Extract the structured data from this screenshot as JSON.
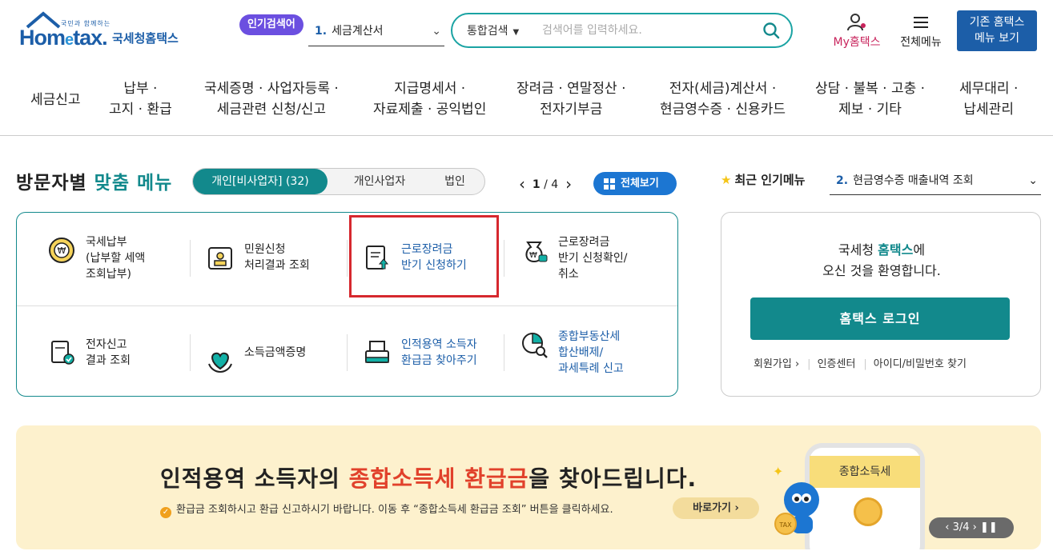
{
  "header": {
    "logo_sub": "국민과 함께하는",
    "logo_brand_a": "Hom",
    "logo_brand_e": "e",
    "logo_brand_b": "tax.",
    "logo_korean": "국세청홈택스",
    "popular_badge": "인기검색어",
    "popular_num": "1.",
    "popular_value": "세금계산서",
    "search_category": "통합검색",
    "search_placeholder": "검색어를 입력하세요.",
    "my_hometax": "My홈택스",
    "all_menu": "전체메뉴",
    "old_view_line1": "기존 홈택스",
    "old_view_line2": "메뉴 보기"
  },
  "nav": [
    {
      "l1": "세금신고",
      "l2": ""
    },
    {
      "l1": "납부 ·",
      "l2": "고지 · 환급"
    },
    {
      "l1": "국세증명 · 사업자등록 ·",
      "l2": "세금관련 신청/신고"
    },
    {
      "l1": "지급명세서 ·",
      "l2": "자료제출 · 공익법인"
    },
    {
      "l1": "장려금 · 연말정산 ·",
      "l2": "전자기부금"
    },
    {
      "l1": "전자(세금)계산서 ·",
      "l2": "현금영수증 · 신용카드"
    },
    {
      "l1": "상담 · 불복 · 고충 ·",
      "l2": "제보 · 기타"
    },
    {
      "l1": "세무대리 ·",
      "l2": "납세관리"
    }
  ],
  "visit": {
    "title_a": "방문자별 ",
    "title_b": "맞춤 메뉴",
    "tabs": [
      "개인[비사업자] (32)",
      "개인사업자",
      "법인"
    ],
    "page_current": "1",
    "page_sep": " / ",
    "page_total": "4",
    "view_all": "전체보기"
  },
  "recent": {
    "label": "최근 인기메뉴",
    "num": "2.",
    "value": "현금영수증 매출내역 조회"
  },
  "menu_items": [
    {
      "lines": [
        "국세납부",
        "(납부할 세액",
        "조회납부)"
      ]
    },
    {
      "lines": [
        "민원신청",
        "처리결과 조회"
      ]
    },
    {
      "lines": [
        "근로장려금",
        "반기 신청하기"
      ]
    },
    {
      "lines": [
        "근로장려금",
        "반기 신청확인/",
        "취소"
      ]
    },
    {
      "lines": [
        "전자신고",
        "결과 조회"
      ]
    },
    {
      "lines": [
        "소득금액증명"
      ]
    },
    {
      "lines": [
        "인적용역 소득자",
        "환급금 찾아주기"
      ]
    },
    {
      "lines": [
        "종합부동산세",
        "합산배제/",
        "과세특례 신고"
      ]
    }
  ],
  "login": {
    "welcome_a": "국세청 ",
    "welcome_b": "홈택스",
    "welcome_c": "에",
    "welcome_line2": "오신 것을 환영합니다.",
    "button": "홈택스 로그인",
    "links": [
      "회원가입 ›",
      "인증센터",
      "아이디/비밀번호 찾기"
    ]
  },
  "banner": {
    "headline_a": "인적용역 소득자의 ",
    "headline_b": "종합소득세 환급금",
    "headline_c": "을 찾아드립니다.",
    "note": "환급금 조회하시고 환급 신고하시기 바랍니다. 이동 후 “종합소득세 환급금 조회” 버튼을 클릭하세요.",
    "go_button": "바로가기 ›",
    "phone_title": "종합소득세",
    "slide_text": "‹ 3/4 ›  ❚❚"
  },
  "colors": {
    "teal": "#12898c",
    "blue": "#1c5ea8",
    "red_highlight": "#d6282e",
    "banner_bg": "#fdf1cd",
    "banner_red": "#e1412b"
  }
}
